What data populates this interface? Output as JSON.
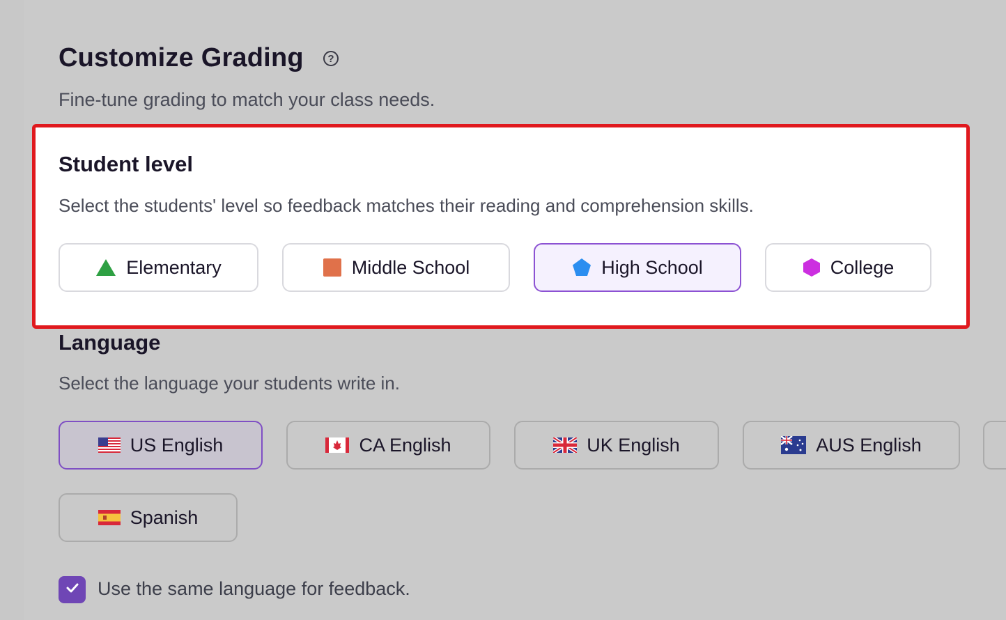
{
  "header": {
    "title": "Customize Grading",
    "help_icon": "?",
    "subtitle": "Fine-tune grading to match your class needs."
  },
  "student_level": {
    "title": "Student level",
    "description": "Select the students' level so feedback matches their reading and comprehension skills.",
    "options": [
      {
        "label": "Elementary",
        "icon": "triangle-icon",
        "color": "#2ea043",
        "selected": false
      },
      {
        "label": "Middle School",
        "icon": "square-icon",
        "color": "#e0714a",
        "selected": false
      },
      {
        "label": "High School",
        "icon": "pentagon-icon",
        "color": "#2b8ef0",
        "selected": true
      },
      {
        "label": "College",
        "icon": "hexagon-icon",
        "color": "#cc2fe0",
        "selected": false
      }
    ]
  },
  "language": {
    "title": "Language",
    "description": "Select the language your students write in.",
    "options": [
      {
        "label": "US English",
        "icon": "us-flag-icon",
        "selected": true
      },
      {
        "label": "CA English",
        "icon": "canada-flag-icon",
        "selected": false
      },
      {
        "label": "UK English",
        "icon": "uk-flag-icon",
        "selected": false
      },
      {
        "label": "AUS English",
        "icon": "australia-flag-icon",
        "selected": false
      },
      {
        "label": "Spanish",
        "icon": "spain-flag-icon",
        "selected": false
      }
    ],
    "feedback_checkbox": {
      "label": "Use the same language for feedback.",
      "checked": true
    }
  },
  "colors": {
    "accent_purple": "#8c52d3",
    "highlight_red": "#e0191e",
    "checkbox_purple": "#6f46b5"
  }
}
